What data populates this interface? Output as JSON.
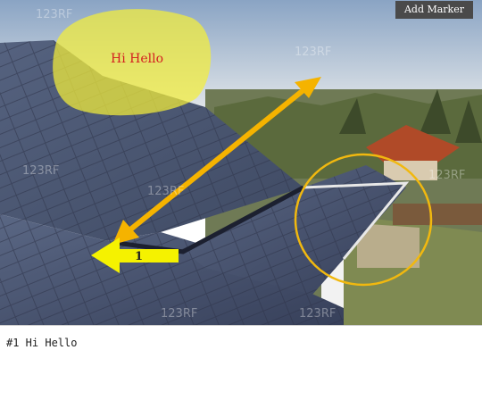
{
  "toolbar": {
    "add_marker_label": "Add Marker"
  },
  "annotations": {
    "highlight_text": "Hi Hello",
    "marker_number": "1"
  },
  "notes": {
    "text": "#1 Hi Hello"
  },
  "colors": {
    "highlight": "#f4ee3a",
    "arrow": "#f5b300",
    "circle": "#f1b80f",
    "highlight_text": "#d42020"
  },
  "watermark": {
    "text": "123RF"
  }
}
